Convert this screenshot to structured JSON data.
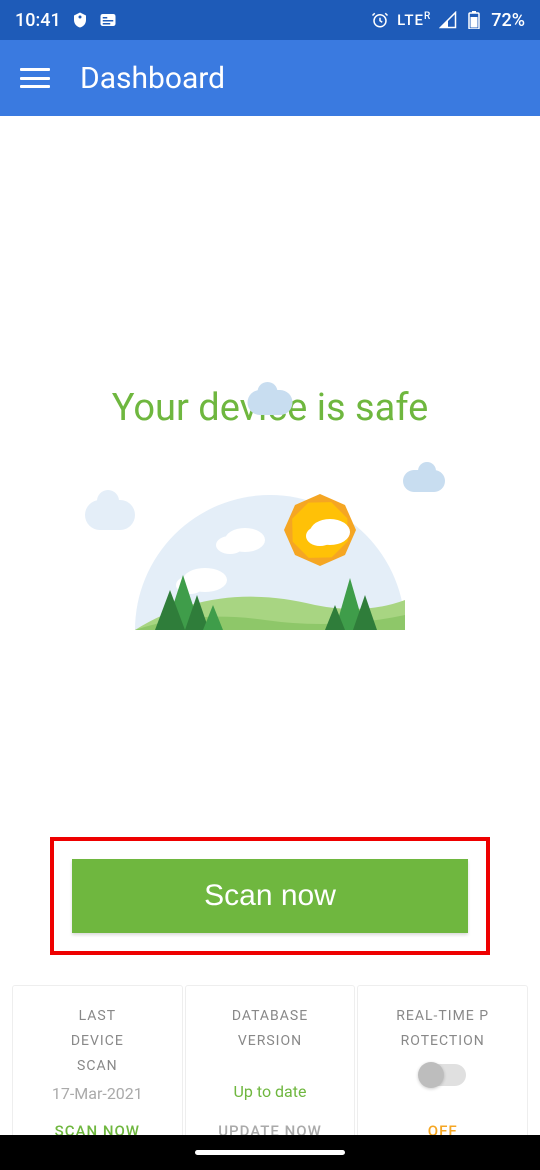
{
  "status_bar": {
    "time": "10:41",
    "network": "LTE",
    "network_sup": "R",
    "battery": "72%"
  },
  "app_bar": {
    "title": "Dashboard"
  },
  "main": {
    "status_text": "Your device is safe",
    "scan_button": "Scan now"
  },
  "cards": {
    "last_scan": {
      "title_line1": "LAST",
      "title_line2": "DEVICE",
      "title_line3": "SCAN",
      "value": "17-Mar-2021",
      "action": "SCAN NOW"
    },
    "database": {
      "title_line1": "DATABASE",
      "title_line2": "VERSION",
      "value": "Up to date",
      "action": "UPDATE NOW"
    },
    "realtime": {
      "title_line1": "REAL-TIME P",
      "title_line2": "ROTECTION",
      "action": "OFF"
    }
  }
}
